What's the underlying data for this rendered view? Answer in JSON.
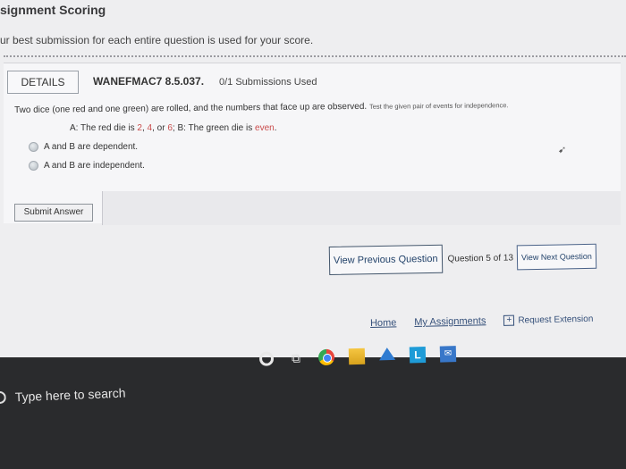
{
  "header": {
    "title": "signment Scoring",
    "subtitle": "ur best submission for each entire question is used for your score."
  },
  "question": {
    "details_label": "DETAILS",
    "id": "WANEFMAC7 8.5.037.",
    "submissions": "0/1 Submissions Used",
    "text_main": "Two dice (one red and one green) are rolled, and the numbers that face up are observed.",
    "text_instruction": "Test the given pair of events for independence.",
    "events": {
      "a_label": "A: The red die is",
      "a_v1": "2",
      "a_v2": "4",
      "a_or": "or",
      "a_v3": "6",
      "b_label": "B: The green die is",
      "b_value": "even"
    },
    "options": [
      "A and B are dependent.",
      "A and B are independent."
    ],
    "submit_label": "Submit Answer"
  },
  "nav": {
    "prev_label": "View Previous Question",
    "counter": "Question 5 of 13",
    "next_label": "View Next Question"
  },
  "footer": {
    "home": "Home",
    "my_assignments": "My Assignments",
    "request_extension": "Request Extension"
  },
  "taskbar": {
    "search_placeholder": "Type here to search",
    "icons": [
      "cortana-icon",
      "task-view-icon",
      "chrome-icon",
      "file-explorer-icon",
      "store-icon",
      "lms-app-icon",
      "mail-icon"
    ]
  },
  "colors": {
    "accent_red": "#c94b4b",
    "link_blue": "#35507a",
    "taskbar": "#2a2b2d"
  }
}
